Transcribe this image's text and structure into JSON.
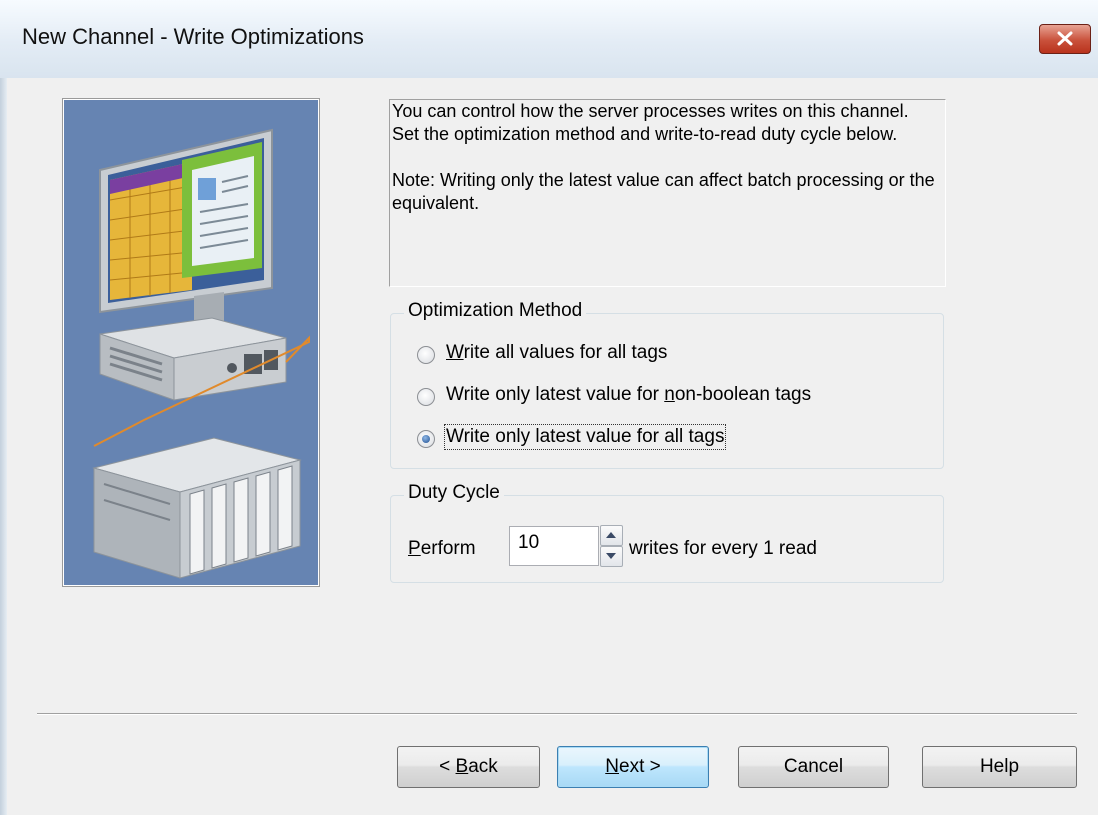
{
  "window": {
    "title": "New Channel - Write Optimizations"
  },
  "info": {
    "paragraph1": "You can control how the server processes writes on this channel.  Set the optimization method and write-to-read duty cycle below.",
    "paragraph2": "Note:  Writing only the latest value can affect batch processing or the equivalent."
  },
  "optimization": {
    "legend": "Optimization Method",
    "selected_index": 2,
    "options": [
      {
        "mnemonic": "W",
        "rest": "rite all values for all tags"
      },
      {
        "pre": "Write only latest value for ",
        "mnemonic": "n",
        "rest": "on-boolean tags"
      },
      {
        "label": "Write only latest value for all tags"
      }
    ]
  },
  "duty_cycle": {
    "legend": "Duty Cycle",
    "perform_mnemonic": "P",
    "perform_rest": "erform",
    "value": "10",
    "suffix": "writes for every 1 read"
  },
  "buttons": {
    "back_prefix": "< ",
    "back_mnemonic": "B",
    "back_rest": "ack",
    "next_mnemonic": "N",
    "next_rest": "ext >",
    "cancel": "Cancel",
    "help": "Help"
  },
  "colors": {
    "art_background": "#6684b2",
    "default_button_border": "#3c7fb1"
  }
}
